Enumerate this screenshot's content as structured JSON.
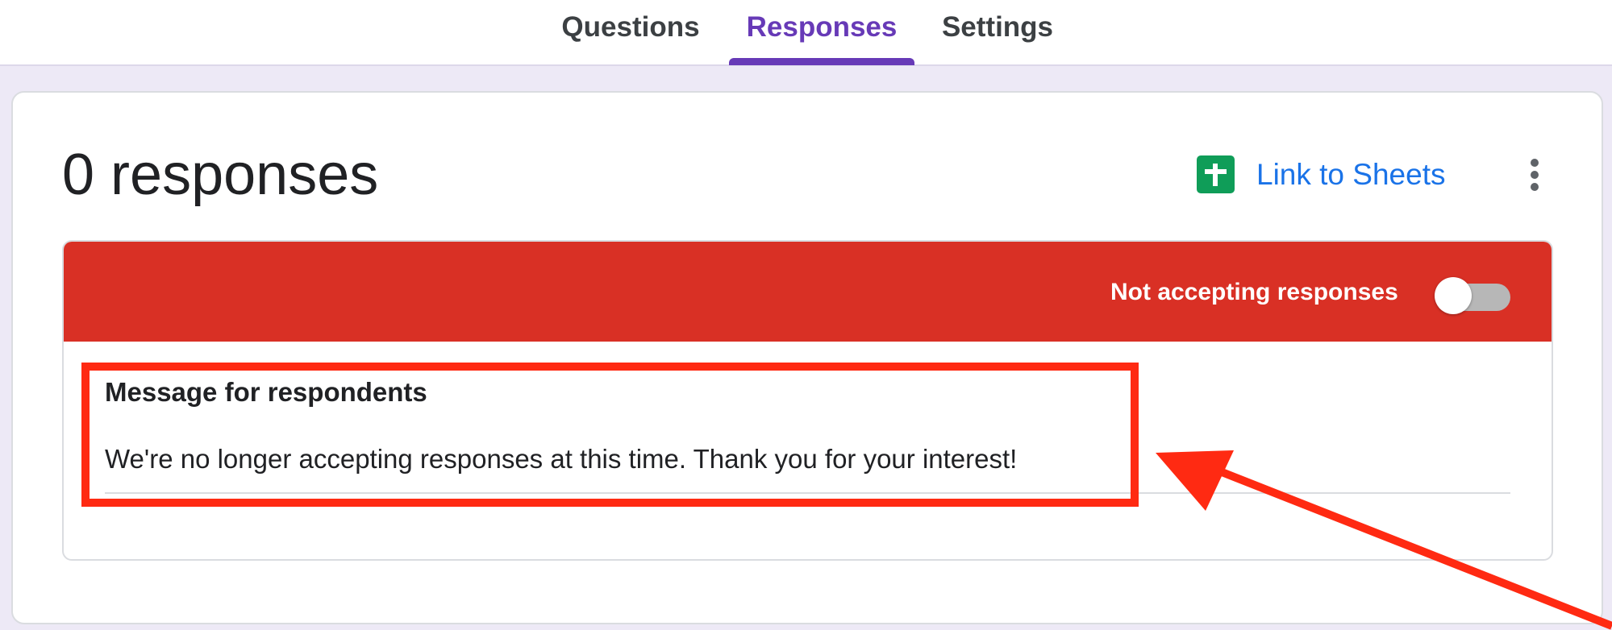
{
  "tabs": {
    "questions": "Questions",
    "responses": "Responses",
    "settings": "Settings"
  },
  "header": {
    "responses_count": "0 responses",
    "link_to_sheets": "Link to Sheets"
  },
  "status_panel": {
    "label": "Not accepting responses",
    "accepting": false
  },
  "message": {
    "heading": "Message for respondents",
    "value": "We're no longer accepting responses at this time. Thank you for your interest!"
  },
  "colors": {
    "accent": "#673ab7",
    "status_red": "#d93025",
    "annotation_red": "#ff2a12",
    "sheets_green": "#0f9d58",
    "link_blue": "#1a73e8"
  }
}
